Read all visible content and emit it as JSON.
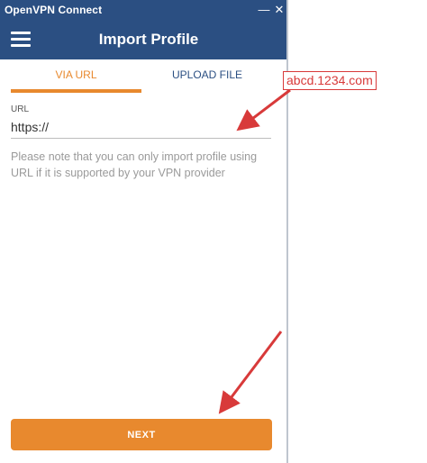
{
  "window": {
    "title": "OpenVPN Connect",
    "min_glyph": "—",
    "close_glyph": "✕"
  },
  "appbar": {
    "title": "Import Profile",
    "menu_icon": "hamburger-menu-icon"
  },
  "tabs": [
    {
      "label": "VIA URL",
      "active": true
    },
    {
      "label": "UPLOAD FILE",
      "active": false
    }
  ],
  "url_field": {
    "label": "URL",
    "value": "https://"
  },
  "note": "Please note that you can only import profile using URL if it is supported by your VPN provider",
  "next_button": {
    "label": "NEXT"
  },
  "annotation": {
    "callout_text": "abcd.1234.com"
  },
  "colors": {
    "primary": "#2b4f82",
    "accent": "#e8892e",
    "annotation": "#d83a3a"
  }
}
